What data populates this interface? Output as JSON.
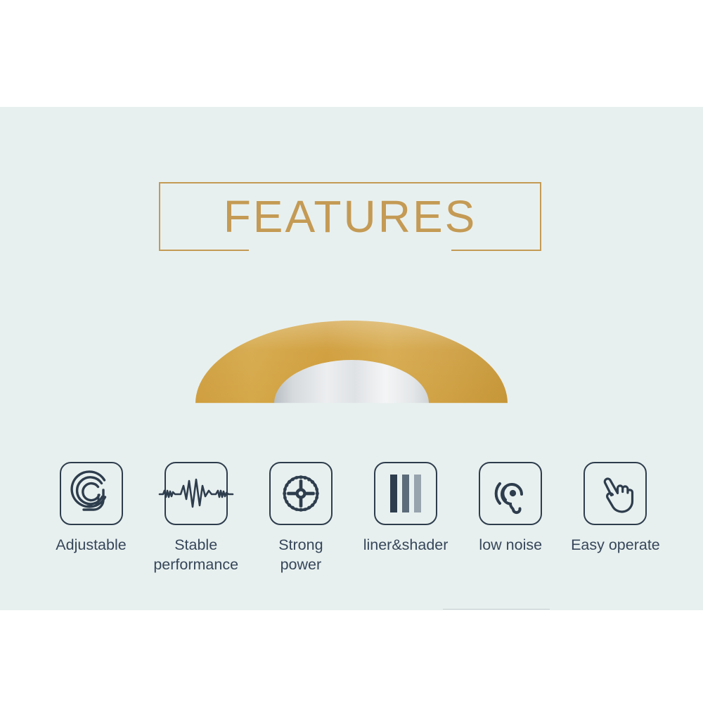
{
  "page": {
    "background_color": "#ffffff",
    "panel_color": "#e8f0ef",
    "accent_gold": "#c49a54",
    "icon_stroke": "#2e3d4d",
    "label_color": "#36465a"
  },
  "header": {
    "title": "FEATURES"
  },
  "hero": {
    "image_name": "tattoo-machine-gold-arc",
    "gold_color": "#d3a243",
    "inner_color": "#f2f3f4"
  },
  "features": [
    {
      "id": "adjustable",
      "label": "Adjustable",
      "icon": "spiral-dial-icon"
    },
    {
      "id": "stable-performance",
      "label": "Stable\nperformance",
      "icon": "waveform-icon"
    },
    {
      "id": "strong-power",
      "label": "Strong\npower",
      "icon": "gear-icon"
    },
    {
      "id": "liner-shader",
      "label": "liner&shader",
      "icon": "bars-icon"
    },
    {
      "id": "low-noise",
      "label": "low noise",
      "icon": "ear-icon"
    },
    {
      "id": "easy-operate",
      "label": "Easy operate",
      "icon": "pointing-hand-icon"
    }
  ]
}
